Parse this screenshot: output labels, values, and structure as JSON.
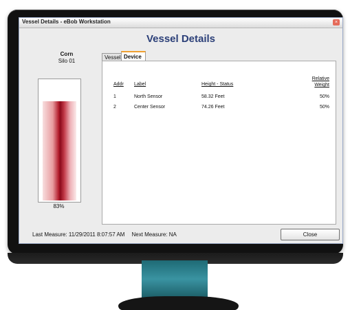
{
  "window": {
    "title": "Vessel Details - eBob Workstation",
    "heading": "Vessel Details"
  },
  "silo": {
    "name": "Corn",
    "sub": "Silo 01",
    "percent_label": "83%",
    "fill_fraction": 0.83,
    "fill_color": "#a3101f"
  },
  "tabs": [
    {
      "label": "Vessel",
      "active": false
    },
    {
      "label": "Device",
      "active": true
    }
  ],
  "table": {
    "headers": {
      "addr": "Addr",
      "label": "Label",
      "height_status": "Height - Status",
      "weight_line1": "Relative",
      "weight_line2": "Weight"
    },
    "rows": [
      {
        "addr": "1",
        "label": "North Sensor",
        "height": "58.32 Feet",
        "weight": "50%"
      },
      {
        "addr": "2",
        "label": "Center Sensor",
        "height": "74.26 Feet",
        "weight": "50%"
      }
    ]
  },
  "footer": {
    "last_measure": "Last Measure: 11/29/2011 8:07:57 AM",
    "next_measure": "Next Measure: NA",
    "close_label": "Close"
  },
  "colors": {
    "heading": "#2b3f78",
    "stand": "#3a93a1",
    "bezel": "#111111"
  }
}
